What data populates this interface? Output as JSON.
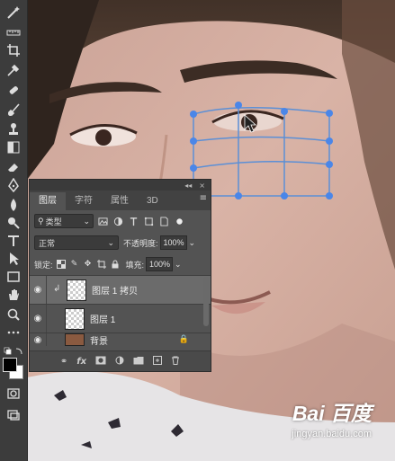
{
  "toolbar": {
    "icons": [
      "magic-wand-icon",
      "ruler-icon",
      "crop-icon",
      "eyedropper-icon",
      "healing-brush-icon",
      "brush-icon",
      "clone-stamp-icon",
      "history-brush-icon",
      "eraser-icon",
      "gradient-icon",
      "blur-icon",
      "dodge-icon",
      "pen-icon",
      "type-icon",
      "path-select-icon",
      "rectangle-icon",
      "hand-icon",
      "zoom-icon",
      "more-icon",
      "default-colors-icon",
      "swap-colors-icon",
      "quick-mask-icon",
      "screen-mode-icon"
    ],
    "foreground_color": "#000000",
    "background_color": "#ffffff"
  },
  "panel": {
    "header_collapse": "◂◂",
    "header_close": "×",
    "tabs": [
      {
        "label": "图层"
      },
      {
        "label": "字符"
      },
      {
        "label": "属性"
      },
      {
        "label": "3D"
      }
    ],
    "filter": {
      "label": "类型"
    },
    "blend_mode": "正常",
    "opacity_label": "不透明度:",
    "opacity_value": "100%",
    "lock_label": "锁定:",
    "fill_label": "填充:",
    "fill_value": "100%",
    "layers": [
      {
        "name": "图层 1 拷贝",
        "selected": true
      },
      {
        "name": "图层 1",
        "selected": false
      },
      {
        "name": "背景",
        "selected": false
      }
    ],
    "footer_fx": "fx"
  },
  "watermark": {
    "brand": "Bai 百度",
    "sub": "jingyan.baidu.com"
  },
  "colors": {
    "panel_bg": "#535353",
    "selected_row": "#6b6b6b",
    "warp_handle": "#4a86e8"
  }
}
